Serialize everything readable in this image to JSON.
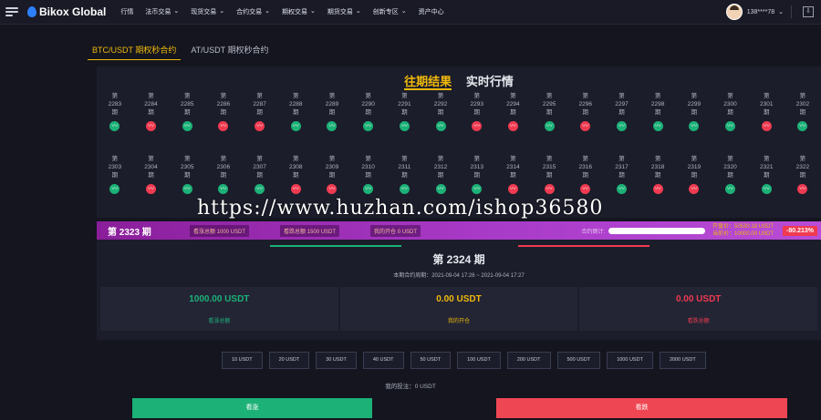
{
  "header": {
    "brand": "Bikox Global",
    "nav": [
      "行情",
      "法币交易",
      "现货交易",
      "合约交易",
      "期权交易",
      "期货交易",
      "创新专区",
      "资产中心"
    ],
    "nav_dropdown": [
      false,
      true,
      true,
      true,
      true,
      true,
      true,
      false
    ],
    "user_phone": "138****78"
  },
  "tabs": [
    "BTC/USDT 期权秒合约",
    "AT/USDT 期权秒合约"
  ],
  "results_panel": {
    "tab_history": "往期结果",
    "tab_realtime": "实时行情",
    "row1": [
      {
        "n": "2283",
        "r": "up"
      },
      {
        "n": "2284",
        "r": "down"
      },
      {
        "n": "2285",
        "r": "up"
      },
      {
        "n": "2286",
        "r": "down"
      },
      {
        "n": "2287",
        "r": "down"
      },
      {
        "n": "2288",
        "r": "up"
      },
      {
        "n": "2289",
        "r": "up"
      },
      {
        "n": "2290",
        "r": "up"
      },
      {
        "n": "2291",
        "r": "up"
      },
      {
        "n": "2292",
        "r": "up"
      },
      {
        "n": "2293",
        "r": "down"
      },
      {
        "n": "2294",
        "r": "down"
      },
      {
        "n": "2295",
        "r": "up"
      },
      {
        "n": "2296",
        "r": "down"
      },
      {
        "n": "2297",
        "r": "up"
      },
      {
        "n": "2298",
        "r": "up"
      },
      {
        "n": "2299",
        "r": "up"
      },
      {
        "n": "2300",
        "r": "up"
      },
      {
        "n": "2301",
        "r": "down"
      },
      {
        "n": "2302",
        "r": "up"
      }
    ],
    "row2": [
      {
        "n": "2303",
        "r": "up"
      },
      {
        "n": "2304",
        "r": "down"
      },
      {
        "n": "2305",
        "r": "up"
      },
      {
        "n": "2306",
        "r": "up"
      },
      {
        "n": "2307",
        "r": "up"
      },
      {
        "n": "2308",
        "r": "down"
      },
      {
        "n": "2309",
        "r": "down"
      },
      {
        "n": "2310",
        "r": "up"
      },
      {
        "n": "2311",
        "r": "up"
      },
      {
        "n": "2312",
        "r": "up"
      },
      {
        "n": "2313",
        "r": "up"
      },
      {
        "n": "2314",
        "r": "down"
      },
      {
        "n": "2315",
        "r": "down"
      },
      {
        "n": "2316",
        "r": "down"
      },
      {
        "n": "2317",
        "r": "up"
      },
      {
        "n": "2318",
        "r": "down"
      },
      {
        "n": "2319",
        "r": "down"
      },
      {
        "n": "2320",
        "r": "up"
      },
      {
        "n": "2321",
        "r": "up"
      },
      {
        "n": "2322",
        "r": "down"
      }
    ],
    "period_prefix": "第",
    "period_suffix": "期"
  },
  "watermark": "https://www.huzhan.com/ishop36580",
  "current_bar": {
    "period": "第 2323 期",
    "rise_total": "看涨总额 1000 USDT",
    "fall_total": "看跌总额 1500 USDT",
    "my_position": "我的开仓 0 USDT",
    "countdown_label": "合约倒计:",
    "open_price": "开盘价：50530.18 USDT",
    "current_price": "当前价：10000.00 USDT",
    "change_pct": "-80.213%"
  },
  "next_period": {
    "title": "第 2324 期",
    "cycle": "本期合约周期：2021-09-04 17:26 ~ 2021-09-04 17:27",
    "stats": [
      {
        "value": "1000.00 USDT",
        "label": "看涨总额",
        "color": "#1cb177"
      },
      {
        "value": "0.00 USDT",
        "label": "我的开仓",
        "color": "#f0b90b"
      },
      {
        "value": "0.00 USDT",
        "label": "看跌总额",
        "color": "#ef3a50"
      }
    ]
  },
  "amounts": [
    "10 USDT",
    "20 USDT",
    "30 USDT",
    "40 USDT",
    "50 USDT",
    "100 USDT",
    "200 USDT",
    "500 USDT",
    "1000 USDT",
    "2000 USDT"
  ],
  "my_investment": "我的投注：0 USDT",
  "buttons": {
    "rise": "看涨",
    "fall": "看跌"
  },
  "colors": {
    "accent": "#f0b90b",
    "up": "#1cb177",
    "down": "#ef3a50",
    "bar": "#a93bc9"
  }
}
